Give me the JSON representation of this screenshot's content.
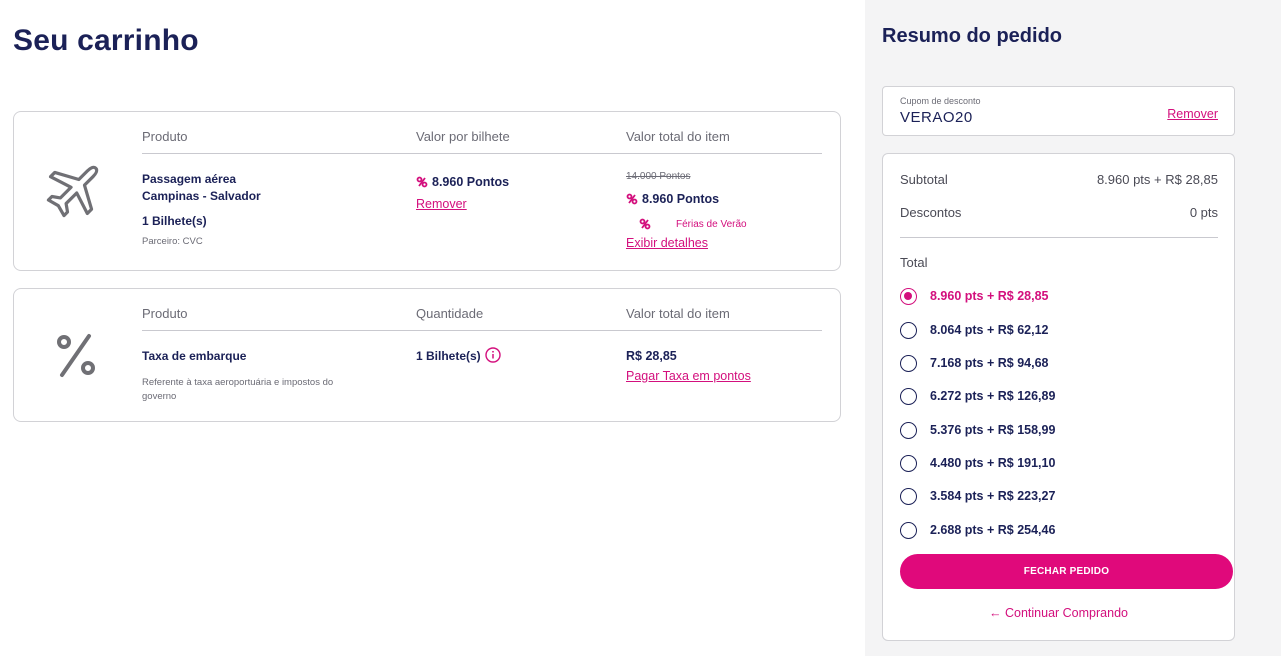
{
  "page": {
    "title": "Seu carrinho"
  },
  "colors": {
    "accent": "#e0097b",
    "navy": "#1b2157",
    "border": "#d2d2d6"
  },
  "cart": {
    "flight": {
      "icon": "airplane-icon",
      "headers": {
        "product": "Produto",
        "unit_value": "Valor por bilhete",
        "total_value": "Valor total do item"
      },
      "name_line1": "Passagem aérea",
      "name_line2": "Campinas - Salvador",
      "tickets": "1 Bilhete(s)",
      "partner": "Parceiro: CVC",
      "unit_points": "8.960 Pontos",
      "remove_label": "Remover",
      "original_points": "14.000 Pontos",
      "total_points": "8.960 Pontos",
      "promo_label": "Férias de Verão",
      "details_label": "Exibir detalhes"
    },
    "boarding_fee": {
      "icon": "percent-icon",
      "headers": {
        "product": "Produto",
        "quantity": "Quantidade",
        "total_value": "Valor total do item"
      },
      "name": "Taxa de embarque",
      "description_line1": "Referente à taxa aeroportuária e impostos do",
      "description_line2": "governo",
      "quantity": "1 Bilhete(s)",
      "total": "R$ 28,85",
      "pay_points_label": "Pagar Taxa em pontos"
    }
  },
  "summary": {
    "title": "Resumo do pedido",
    "coupon": {
      "label": "Cupom de desconto",
      "value": "VERAO20",
      "remove_label": "Remover"
    },
    "subtotal_label": "Subtotal",
    "subtotal_value": "8.960 pts + R$ 28,85",
    "discount_label": "Descontos",
    "discount_value": "0 pts",
    "total_label": "Total",
    "options": [
      {
        "label": "8.960 pts + R$ 28,85",
        "selected": true
      },
      {
        "label": "8.064 pts + R$ 62,12",
        "selected": false
      },
      {
        "label": "7.168 pts + R$ 94,68",
        "selected": false
      },
      {
        "label": "6.272 pts + R$ 126,89",
        "selected": false
      },
      {
        "label": "5.376 pts + R$ 158,99",
        "selected": false
      },
      {
        "label": "4.480 pts + R$ 191,10",
        "selected": false
      },
      {
        "label": "3.584 pts + R$ 223,27",
        "selected": false
      },
      {
        "label": "2.688 pts + R$ 254,46",
        "selected": false
      }
    ],
    "checkout_label": "FECHAR PEDIDO",
    "continue_label": "Continuar Comprando"
  }
}
